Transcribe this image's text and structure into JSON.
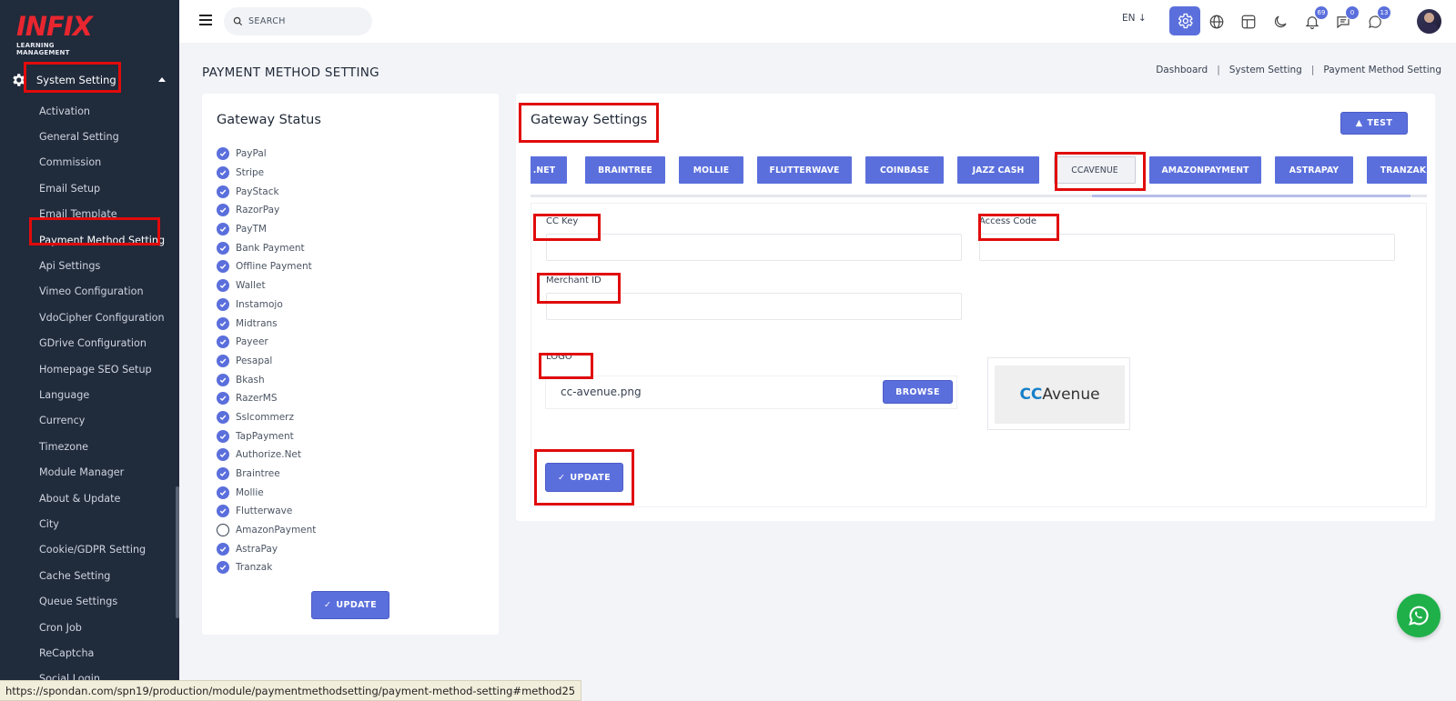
{
  "brand": {
    "name": "INFIX",
    "tagline": "LEARNING MANAGEMENT",
    "accent": "#e8262f"
  },
  "sidebar": {
    "section": "System Setting",
    "items": [
      "Activation",
      "General Setting",
      "Commission",
      "Email Setup",
      "Email Template",
      "Payment Method Setting",
      "Api Settings",
      "Vimeo Configuration",
      "VdoCipher Configuration",
      "GDrive Configuration",
      "Homepage SEO Setup",
      "Language",
      "Currency",
      "Timezone",
      "Module Manager",
      "About & Update",
      "City",
      "Cookie/GDPR Setting",
      "Cache Setting",
      "Queue Settings",
      "Cron Job",
      "ReCaptcha",
      "Social Login"
    ],
    "active": "Payment Method Setting"
  },
  "topbar": {
    "search_placeholder": "SEARCH",
    "language": "EN",
    "notifications_count": "69",
    "messages_count": "0",
    "chat_count": "13",
    "icons": [
      "settings-icon",
      "globe-icon",
      "layout-icon",
      "moon-icon",
      "bell-icon",
      "message-icon",
      "whatsapp-icon"
    ]
  },
  "page": {
    "title": "PAYMENT METHOD SETTING",
    "breadcrumb": [
      "Dashboard",
      "System Setting",
      "Payment Method Setting"
    ]
  },
  "gateway_status": {
    "title": "Gateway Status",
    "items": [
      {
        "name": "PayPal",
        "checked": true
      },
      {
        "name": "Stripe",
        "checked": true
      },
      {
        "name": "PayStack",
        "checked": true
      },
      {
        "name": "RazorPay",
        "checked": true
      },
      {
        "name": "PayTM",
        "checked": true
      },
      {
        "name": "Bank Payment",
        "checked": true
      },
      {
        "name": "Offline Payment",
        "checked": true
      },
      {
        "name": "Wallet",
        "checked": true
      },
      {
        "name": "Instamojo",
        "checked": true
      },
      {
        "name": "Midtrans",
        "checked": true
      },
      {
        "name": "Payeer",
        "checked": true
      },
      {
        "name": "Pesapal",
        "checked": true
      },
      {
        "name": "Bkash",
        "checked": true
      },
      {
        "name": "RazerMS",
        "checked": true
      },
      {
        "name": "Sslcommerz",
        "checked": true
      },
      {
        "name": "TapPayment",
        "checked": true
      },
      {
        "name": "Authorize.Net",
        "checked": true
      },
      {
        "name": "Braintree",
        "checked": true
      },
      {
        "name": "Mollie",
        "checked": true
      },
      {
        "name": "Flutterwave",
        "checked": true
      },
      {
        "name": "AmazonPayment",
        "checked": false
      },
      {
        "name": "AstraPay",
        "checked": true
      },
      {
        "name": "Tranzak",
        "checked": true
      }
    ],
    "update_label": "UPDATE"
  },
  "gateway_settings": {
    "title": "Gateway Settings",
    "test_label": "TEST",
    "tabs": [
      ".NET",
      "BRAINTREE",
      "MOLLIE",
      "FLUTTERWAVE",
      "COINBASE",
      "JAZZ CASH",
      "CCAVENUE",
      "AMAZONPAYMENT",
      "ASTRAPAY",
      "TRANZAK"
    ],
    "active_tab": "CCAVENUE",
    "form": {
      "cc_key_label": "CC Key",
      "cc_key_value": "",
      "access_code_label": "Access Code",
      "access_code_value": "",
      "merchant_id_label": "Merchant ID",
      "merchant_id_value": "",
      "logo_label": "LOGO",
      "logo_file": "cc-avenue.png",
      "browse_label": "BROWSE",
      "logo_preview_cc": "CC",
      "logo_preview_rest": "Avenue",
      "update_label": "UPDATE"
    }
  },
  "statusbar": {
    "url": "https://spondan.com/spn19/production/module/paymentmethodsetting/payment-method-setting#method25"
  },
  "colors": {
    "primary": "#5b6fdc",
    "sidebar_bg": "#202b3c",
    "highlight_box": "#e10b0b"
  }
}
